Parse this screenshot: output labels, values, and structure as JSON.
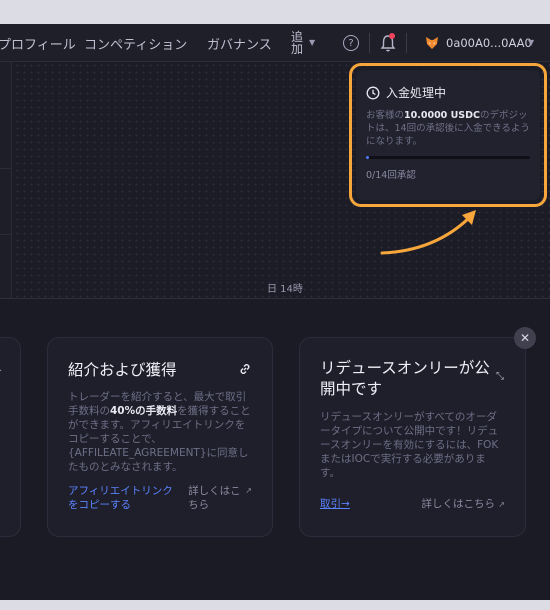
{
  "navbar": {
    "profile": "プロフィール",
    "competition": "コンペティション",
    "governance": "ガバナンス",
    "more_top": "追",
    "more_bottom": "加",
    "help_glyph": "?",
    "wallet_address": "0a00A0...0AA0"
  },
  "chart": {
    "time_label": "日 14時"
  },
  "deposit": {
    "title": "入金処理中",
    "text_before": "お客様の",
    "amount": "10.0000 USDC",
    "text_after": "のデポジットは、14回の承認後に入金できるようになります。",
    "progress_label": "0/14回承認",
    "progress": 0.02
  },
  "referral_card": {
    "title": "紹介および獲得",
    "body_before": "トレーダーを紹介すると、最大で取引手数料の",
    "body_bold": "40%の手数料",
    "body_after": "を獲得することができます。アフィリエイトリンクをコピーすることで、{AFFILEATE_AGREEMENT}に同意したものとみなされます。",
    "copy_link": "アフィリエイトリンクをコピーする",
    "learn_more": "詳しくはこちら"
  },
  "reduce_card": {
    "title": "リデュースオンリーが公開中です",
    "body": "リデュースオンリーがすべてのオーダータイプについて公開中です！リデュースオンリーを有効にするには、FOKまたはIOCで実行する必要があります。",
    "trade_link": "取引→",
    "learn_more": "詳しくはこちら"
  },
  "colors": {
    "accent_orange": "#f6a63a",
    "link_blue": "#5a83ff",
    "background": "#1b1b25"
  },
  "icons": [
    "help-icon",
    "bell-icon",
    "fox-icon",
    "clock-icon",
    "link-icon",
    "collapse-icon",
    "external-link-icon",
    "close-icon"
  ]
}
